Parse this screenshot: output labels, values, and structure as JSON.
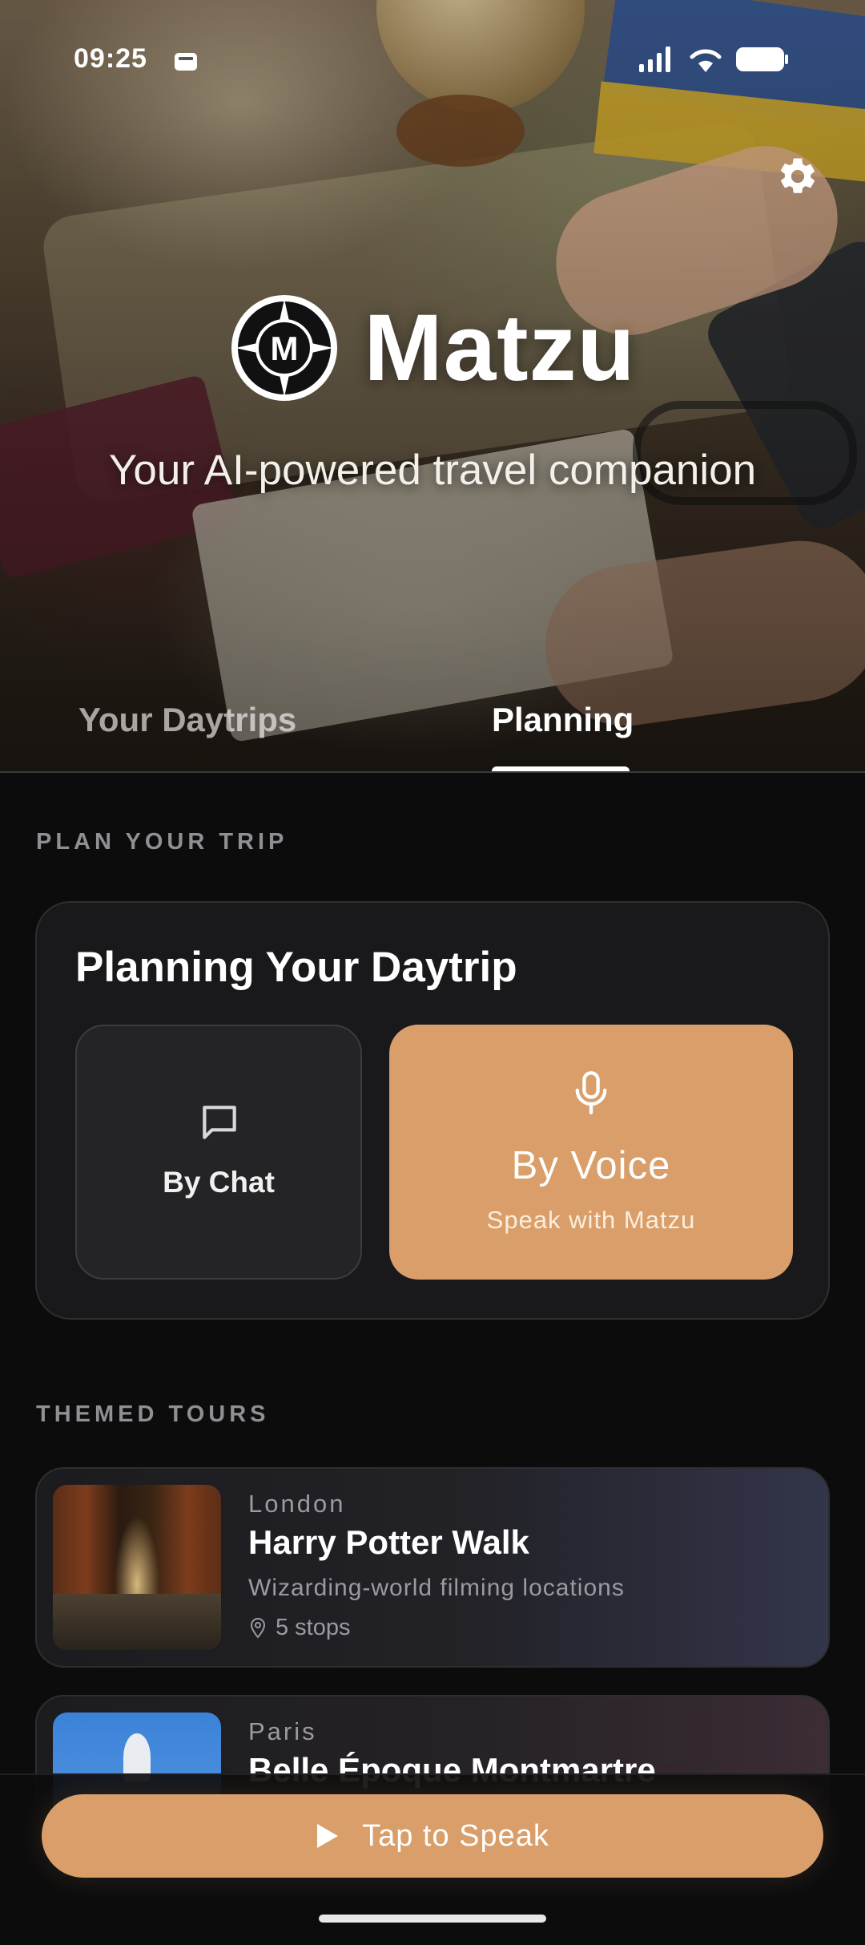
{
  "status_bar": {
    "time": "09:25"
  },
  "header": {
    "app_name": "Matzu",
    "tagline": "Your AI-powered travel companion",
    "logo_letter": "M"
  },
  "tabs": [
    {
      "label": "Your Daytrips",
      "active": false
    },
    {
      "label": "Planning",
      "active": true
    }
  ],
  "planning": {
    "section_label": "PLAN YOUR TRIP",
    "card_title": "Planning Your Daytrip",
    "chat_option": {
      "label": "By Chat",
      "icon": "chat-bubble-icon"
    },
    "voice_option": {
      "label": "By Voice",
      "sublabel": "Speak with Matzu",
      "icon": "microphone-icon"
    }
  },
  "themed_tours": {
    "section_label": "THEMED TOURS",
    "tours": [
      {
        "city": "London",
        "title": "Harry Potter Walk",
        "description": "Wizarding-world filming locations",
        "stops": "5 stops"
      },
      {
        "city": "Paris",
        "title": "Belle Époque Montmartre"
      }
    ]
  },
  "bottom_bar": {
    "speak_label": "Tap to Speak"
  },
  "colors": {
    "accent": "#d99e69",
    "background": "#0c0c0d",
    "card": "#19191b",
    "muted_text": "#9a9aa0"
  }
}
